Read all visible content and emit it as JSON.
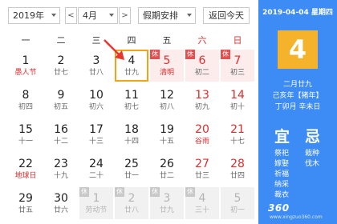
{
  "toolbar": {
    "year": "2019年",
    "prev": "<",
    "month": "4月",
    "next": ">",
    "holiday_select": "假期安排",
    "today_button": "返回今天"
  },
  "weekdays": [
    "一",
    "二",
    "三",
    "四",
    "五",
    "六",
    "日"
  ],
  "weeks": [
    [
      {
        "n": "1",
        "l": "愚人节",
        "lred": true
      },
      {
        "n": "2",
        "l": "廿七"
      },
      {
        "n": "3",
        "l": "廿八"
      },
      {
        "n": "4",
        "l": "廿九",
        "today": true
      },
      {
        "n": "5",
        "l": "清明",
        "lred": true,
        "hol": true,
        "tag": "休"
      },
      {
        "n": "6",
        "l": "初二",
        "hol": true,
        "tag": "休"
      },
      {
        "n": "7",
        "l": "初三",
        "hol": true,
        "tag": "休"
      }
    ],
    [
      {
        "n": "8",
        "l": "初四"
      },
      {
        "n": "9",
        "l": "初五"
      },
      {
        "n": "10",
        "l": "初六"
      },
      {
        "n": "11",
        "l": "初七"
      },
      {
        "n": "12",
        "l": "初八"
      },
      {
        "n": "13",
        "l": "初九",
        "red": true
      },
      {
        "n": "14",
        "l": "初十",
        "red": true
      }
    ],
    [
      {
        "n": "15",
        "l": "十一"
      },
      {
        "n": "16",
        "l": "十二"
      },
      {
        "n": "17",
        "l": "十三"
      },
      {
        "n": "18",
        "l": "十四"
      },
      {
        "n": "19",
        "l": "十五"
      },
      {
        "n": "20",
        "l": "谷雨",
        "red": true,
        "lred": true
      },
      {
        "n": "21",
        "l": "十七",
        "red": true
      }
    ],
    [
      {
        "n": "22",
        "l": "地球日",
        "lred": true
      },
      {
        "n": "23",
        "l": "十九"
      },
      {
        "n": "24",
        "l": "二十"
      },
      {
        "n": "25",
        "l": "廿一"
      },
      {
        "n": "26",
        "l": "廿二"
      },
      {
        "n": "27",
        "l": "廿三",
        "red": true
      },
      {
        "n": "28",
        "l": "廿四",
        "red": true
      }
    ],
    [
      {
        "n": "29",
        "l": "廿五"
      },
      {
        "n": "30",
        "l": "廿六"
      },
      {
        "n": "1",
        "l": "劳动节",
        "lred": true,
        "work": true,
        "tag": "休"
      },
      {
        "n": "2",
        "l": "廿八",
        "work": true,
        "tag": "休"
      },
      {
        "n": "3",
        "l": "廿九",
        "work": true,
        "tag": "休"
      },
      {
        "n": "4",
        "l": "三十",
        "work": true,
        "tag": "休"
      },
      {
        "n": "5",
        "l": "初一",
        "work": true
      }
    ]
  ],
  "side": {
    "date_line": "2019-04-04 星期四",
    "day": "4",
    "lunar": "二月廿九",
    "ganzhi_year": "己亥年【猪年】",
    "ganzhi_day": "丁卯月 辛未日",
    "yi_label": "宜",
    "ji_label": "忌",
    "yi": [
      "祭祀",
      "嫁娶",
      "祈福",
      "纳采",
      "裁衣"
    ],
    "ji": [
      "栽种",
      "伐木"
    ]
  },
  "watermark": {
    "brand": "360",
    "sub": "www.xingzuo360.com"
  },
  "colors": {
    "accent_blue": "#3d8cf5",
    "today_orange": "#f3a414",
    "daybox_orange": "#f5b32b",
    "holiday_red": "#e02d2d",
    "holiday_bg": "#fdecec",
    "arrow_red": "#e8372d"
  }
}
